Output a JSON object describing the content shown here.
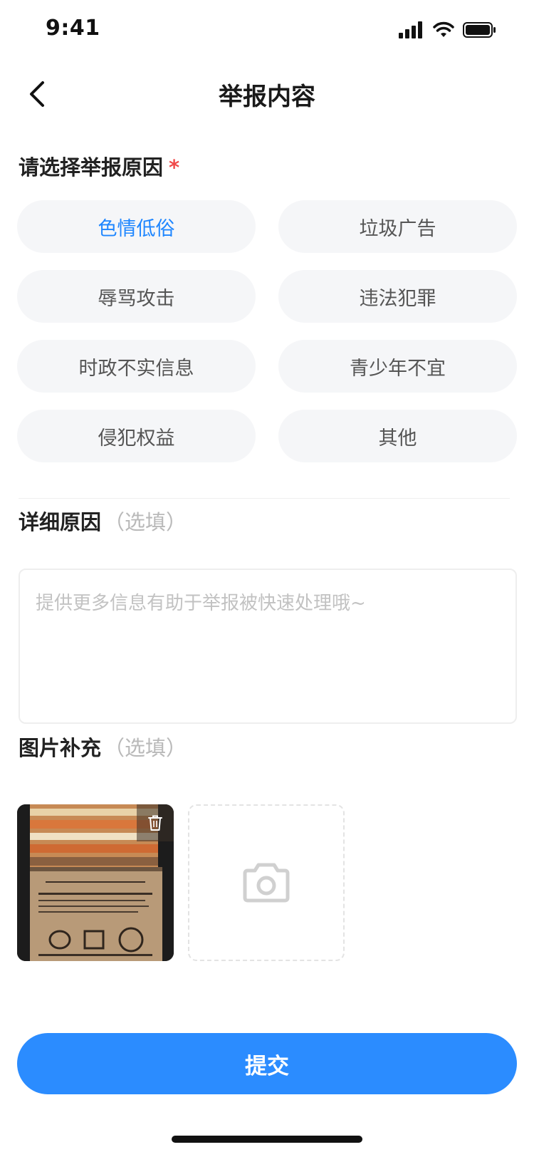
{
  "status_bar": {
    "time": "9:41"
  },
  "nav": {
    "title": "举报内容"
  },
  "reasons_section": {
    "title": "请选择举报原因",
    "required_mark": "*",
    "options": [
      {
        "label": "色情低俗",
        "selected": true
      },
      {
        "label": "垃圾广告",
        "selected": false
      },
      {
        "label": "辱骂攻击",
        "selected": false
      },
      {
        "label": "违法犯罪",
        "selected": false
      },
      {
        "label": "时政不实信息",
        "selected": false
      },
      {
        "label": "青少年不宜",
        "selected": false
      },
      {
        "label": "侵犯权益",
        "selected": false
      },
      {
        "label": "其他",
        "selected": false
      }
    ]
  },
  "detail_section": {
    "title": "详细原因",
    "optional_hint": "（选填）",
    "placeholder": "提供更多信息有助于举报被快速处理哦~",
    "value": ""
  },
  "image_section": {
    "title": "图片补充",
    "optional_hint": "（选填）"
  },
  "submit_label": "提交",
  "colors": {
    "accent": "#2b8cff",
    "selected_text": "#1e86ff",
    "required": "#f04a4a",
    "chip_bg": "#f5f6f8"
  }
}
